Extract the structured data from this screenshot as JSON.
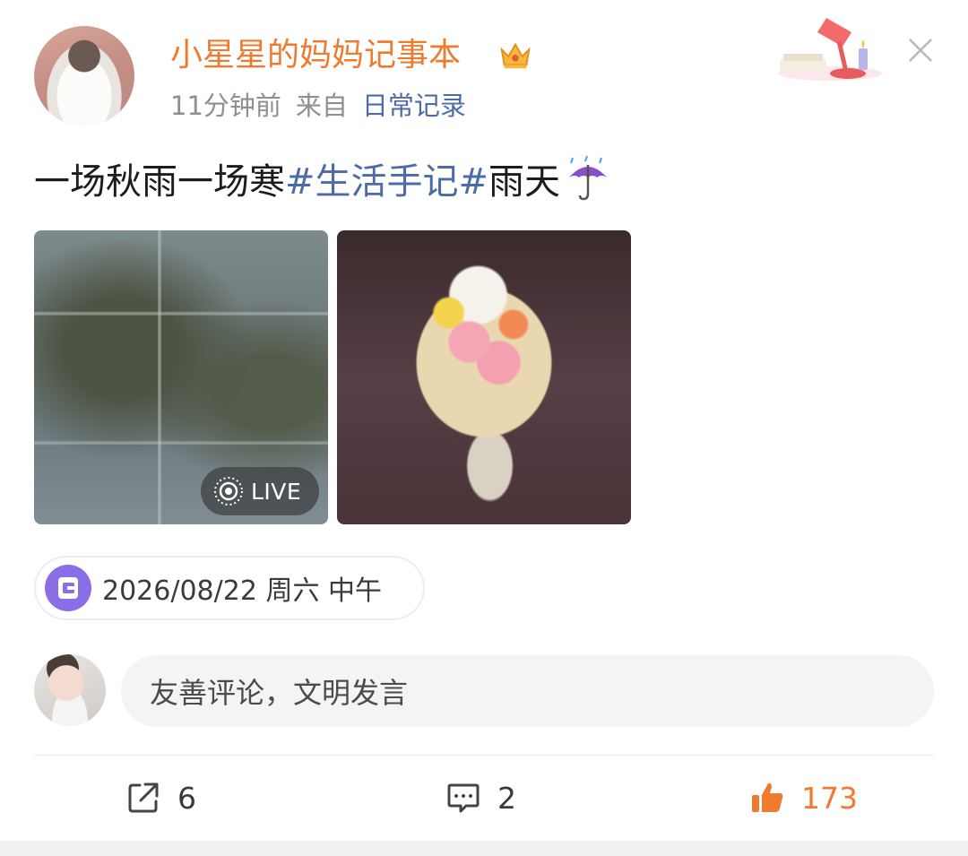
{
  "post": {
    "author": "小星星的妈妈记事本",
    "time_ago": "11分钟前",
    "from_label": "来自",
    "source": "日常记录",
    "text_main": "一场秋雨一场寒",
    "tags": [
      "#生活手记#",
      "雨天"
    ],
    "live_label": "LIVE",
    "date_label": "2026/08/22 周六 中午"
  },
  "comment": {
    "placeholder": "友善评论，文明发言"
  },
  "actions": {
    "forward_count": "6",
    "comment_count": "2",
    "like_count": "173"
  },
  "icons": {
    "vip": "crown-icon",
    "close": "close-icon",
    "lamp": "lamp-decoration-icon",
    "umbrella": "umbrella-rain-icon",
    "live": "live-photo-icon",
    "date": "diary-icon",
    "forward": "forward-icon",
    "comment": "comment-icon",
    "like": "thumbs-up-icon"
  },
  "colors": {
    "author": "#ee7b2f",
    "link": "#4d6ba8",
    "like": "#f07a2d",
    "date_icon": "#8b6fe8"
  }
}
